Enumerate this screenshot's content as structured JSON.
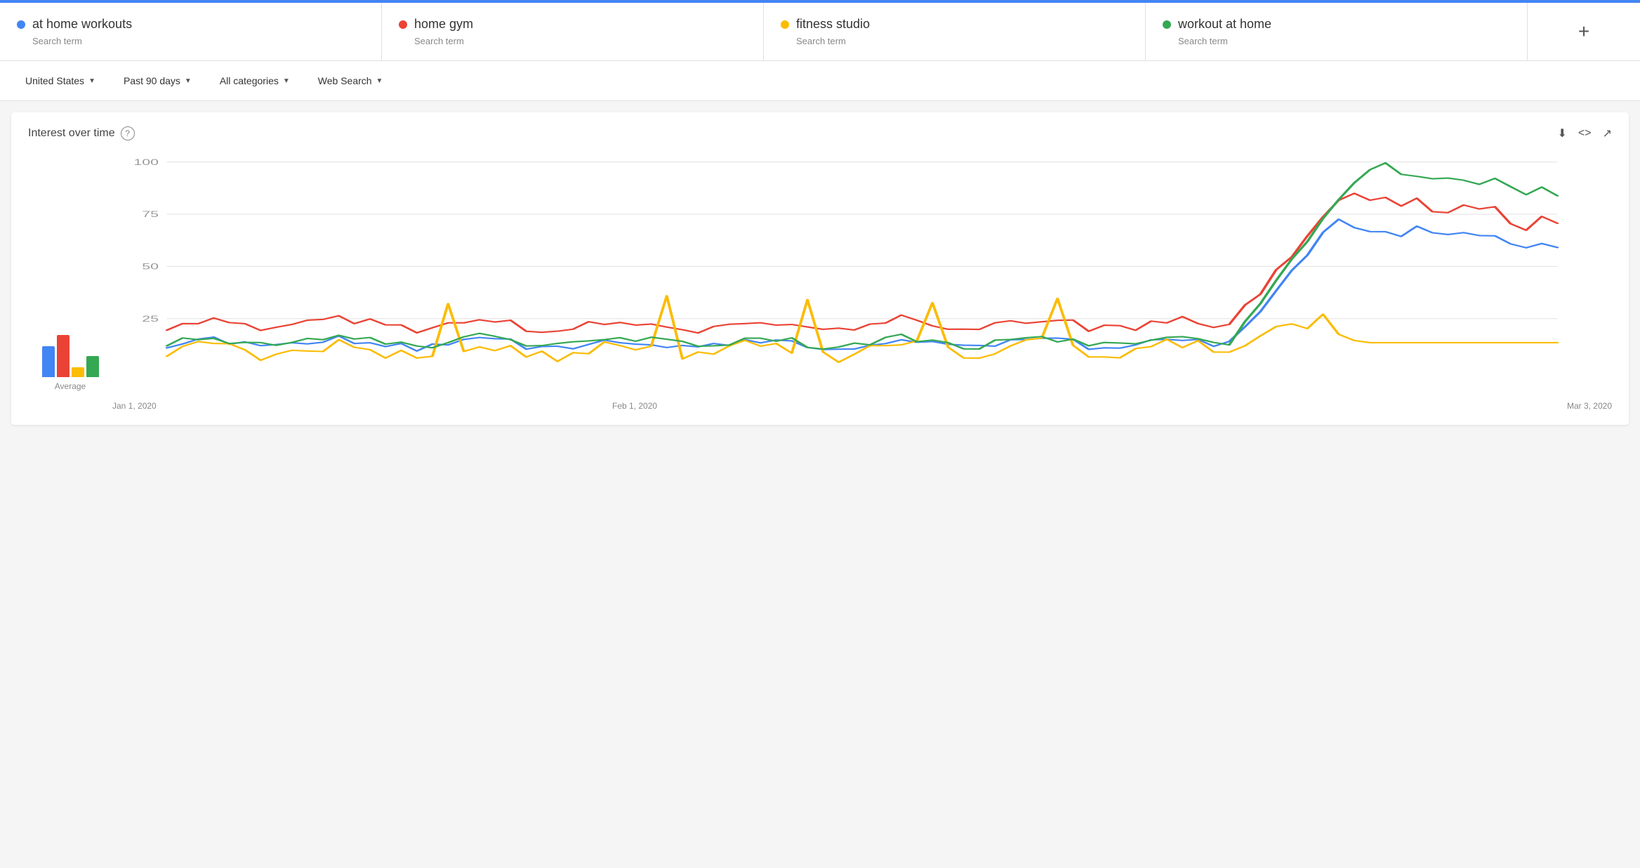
{
  "topbar": {
    "color": "#4285f4"
  },
  "search_terms": [
    {
      "id": "term1",
      "name": "at home workouts",
      "label": "Search term",
      "dot_color": "#4285f4"
    },
    {
      "id": "term2",
      "name": "home gym",
      "label": "Search term",
      "dot_color": "#ea4335"
    },
    {
      "id": "term3",
      "name": "fitness studio",
      "label": "Search term",
      "dot_color": "#fbbc04"
    },
    {
      "id": "term4",
      "name": "workout at home",
      "label": "Search term",
      "dot_color": "#34a853"
    }
  ],
  "add_term_symbol": "+",
  "filters": [
    {
      "id": "region",
      "label": "United States"
    },
    {
      "id": "period",
      "label": "Past 90 days"
    },
    {
      "id": "category",
      "label": "All categories"
    },
    {
      "id": "search_type",
      "label": "Web Search"
    }
  ],
  "chart": {
    "title": "Interest over time",
    "help": "?",
    "x_labels": [
      "Jan 1, 2020",
      "Feb 1, 2020",
      "Mar 3, 2020"
    ],
    "y_labels": [
      "100",
      "75",
      "50",
      "25"
    ],
    "average_label": "Average",
    "average_bars": [
      {
        "color": "#4285f4",
        "height_pct": 55
      },
      {
        "color": "#ea4335",
        "height_pct": 75
      },
      {
        "color": "#fbbc04",
        "height_pct": 18
      },
      {
        "color": "#34a853",
        "height_pct": 38
      }
    ]
  },
  "actions": {
    "download": "⬇",
    "embed": "<>",
    "share": "↗"
  }
}
